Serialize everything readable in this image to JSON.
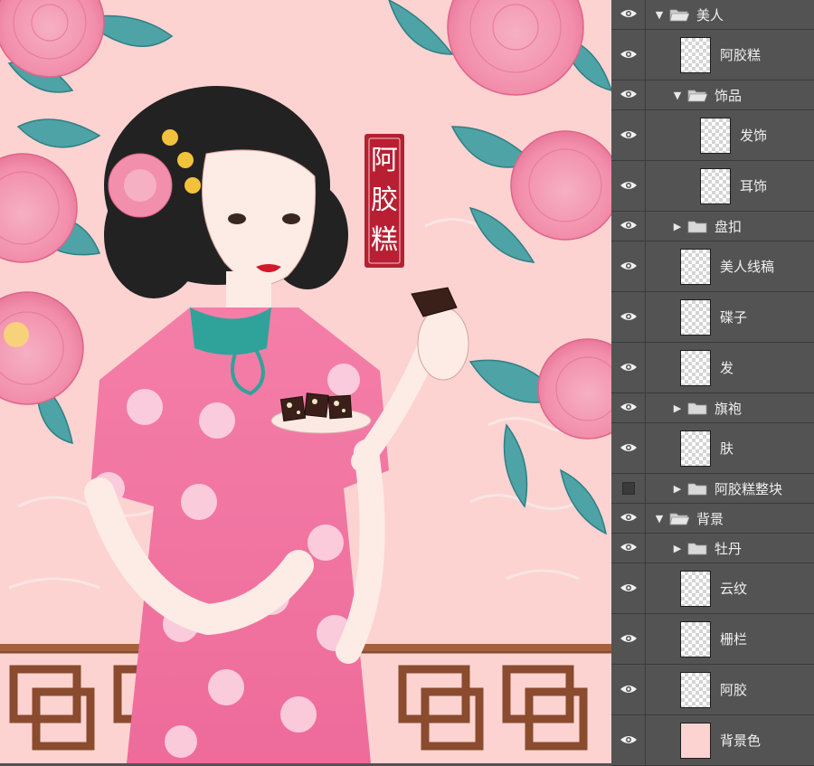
{
  "canvas": {
    "artwork": "Woman in pink qipao holding a plate of ejiao cake among peony blossoms",
    "badge_text": [
      "阿",
      "胶",
      "糕"
    ],
    "colors": {
      "background": "#fcd3d1",
      "qipao": "#f27aa3",
      "collar": "#2fa39a",
      "peony": "#f49cb3",
      "leaf": "#4ea3a6",
      "fence": "#8a4b2e",
      "badge": "#b81f32",
      "hair": "#222222"
    }
  },
  "layers_panel": {
    "colors": {
      "panel": "#535353",
      "divider": "#3b3b3b",
      "text": "#f0f0f0"
    },
    "layers": [
      {
        "name": "美人",
        "kind": "group",
        "expanded": true,
        "visible": true,
        "depth": 0
      },
      {
        "name": "阿胶糕",
        "kind": "layer",
        "visible": true,
        "depth": 1
      },
      {
        "name": "饰品",
        "kind": "group",
        "expanded": true,
        "visible": true,
        "depth": 1
      },
      {
        "name": "发饰",
        "kind": "layer",
        "visible": true,
        "depth": 2
      },
      {
        "name": "耳饰",
        "kind": "layer",
        "visible": true,
        "depth": 2
      },
      {
        "name": "盘扣",
        "kind": "group",
        "expanded": false,
        "visible": true,
        "depth": 1
      },
      {
        "name": "美人线稿",
        "kind": "layer",
        "visible": true,
        "depth": 1
      },
      {
        "name": "碟子",
        "kind": "layer",
        "visible": true,
        "depth": 1
      },
      {
        "name": "发",
        "kind": "layer",
        "visible": true,
        "depth": 1
      },
      {
        "name": "旗袍",
        "kind": "group",
        "expanded": false,
        "visible": true,
        "depth": 1
      },
      {
        "name": "肤",
        "kind": "layer",
        "visible": true,
        "depth": 1
      },
      {
        "name": "阿胶糕整块",
        "kind": "group",
        "expanded": false,
        "visible": false,
        "depth": 1
      },
      {
        "name": "背景",
        "kind": "group",
        "expanded": true,
        "visible": true,
        "depth": 0
      },
      {
        "name": "牡丹",
        "kind": "group",
        "expanded": false,
        "visible": true,
        "depth": 1
      },
      {
        "name": "云纹",
        "kind": "layer",
        "visible": true,
        "depth": 1
      },
      {
        "name": "栅栏",
        "kind": "layer",
        "visible": true,
        "depth": 1
      },
      {
        "name": "阿胶",
        "kind": "layer",
        "visible": true,
        "depth": 1
      },
      {
        "name": "背景色",
        "kind": "layer",
        "visible": true,
        "depth": 1,
        "fill": "#fcd3d1"
      }
    ]
  }
}
